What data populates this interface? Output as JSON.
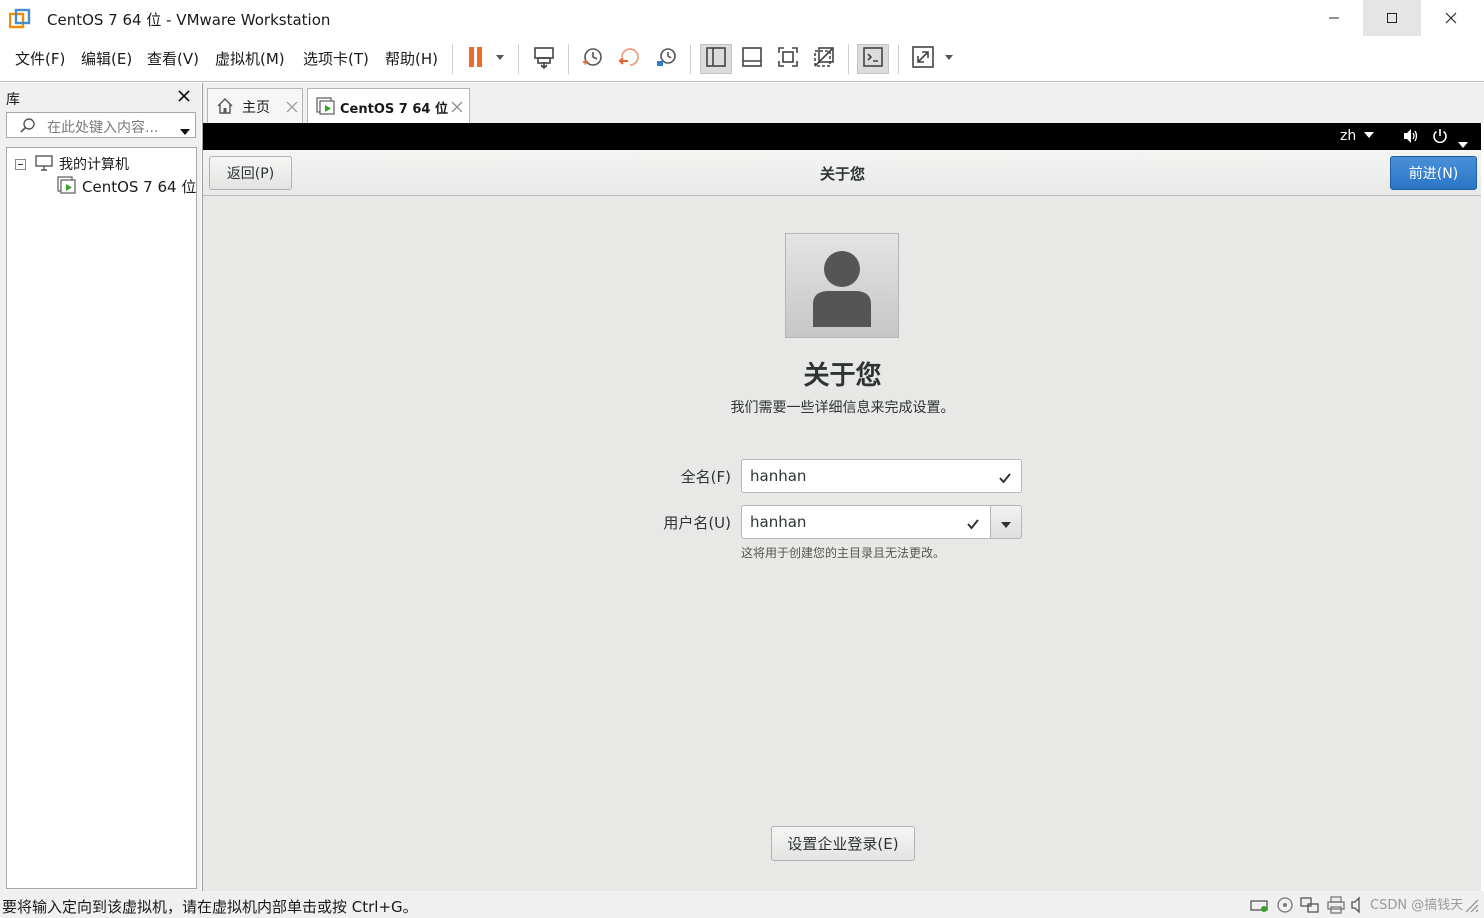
{
  "window": {
    "title": "CentOS 7 64 位 - VMware Workstation"
  },
  "menu": {
    "file": "文件(F)",
    "edit": "编辑(E)",
    "view": "查看(V)",
    "vm": "虚拟机(M)",
    "tabs": "选项卡(T)",
    "help": "帮助(H)"
  },
  "toolbar": {
    "pause_color": "#ee6a26",
    "icons": [
      "pause-icon",
      "send-ctrl-alt-del-icon",
      "snapshot-icon",
      "revert-snapshot-icon",
      "snapshot-manager-icon",
      "show-library-icon",
      "show-thumbnail-icon",
      "fullscreen-icon",
      "unity-icon",
      "console-icon",
      "stretch-icon"
    ]
  },
  "library": {
    "title": "库",
    "search_placeholder": "在此处键入内容...",
    "tree": {
      "root": "我的计算机",
      "vm": "CentOS 7 64 位"
    }
  },
  "tabs": [
    {
      "label": "主页",
      "icon": "home-icon"
    },
    {
      "label": "CentOS 7 64 位",
      "icon": "vm-icon"
    }
  ],
  "gnome": {
    "lang": "zh",
    "header": {
      "back": "返回(P)",
      "title": "关于您",
      "next": "前进(N)",
      "next_color": "#3584e4"
    },
    "heading": "关于您",
    "subtitle": "我们需要一些详细信息来完成设置。",
    "fullname_label": "全名(F)",
    "fullname_value": "hanhan",
    "username_label": "用户名(U)",
    "username_value": "hanhan",
    "hint": "这将用于创建您的主目录且无法更改。",
    "enterprise_button": "设置企业登录(E)"
  },
  "status": {
    "message": "要将输入定向到该虚拟机，请在虚拟机内部单击或按 Ctrl+G。",
    "watermark": "CSDN @搞钱天"
  }
}
